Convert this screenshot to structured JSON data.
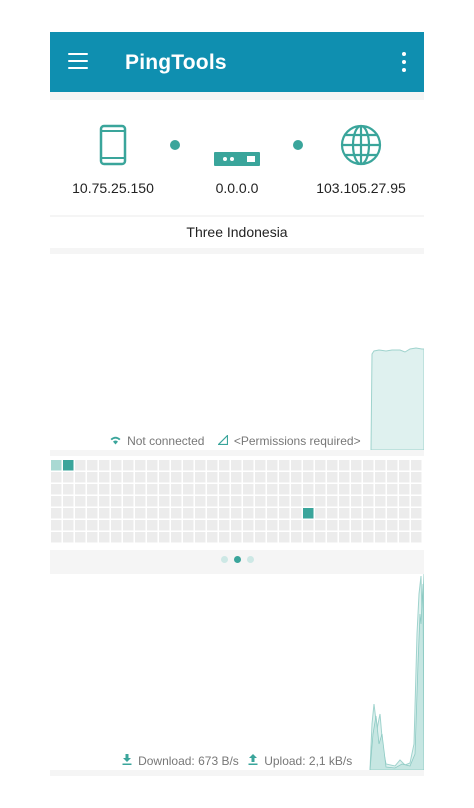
{
  "toolbar": {
    "title": "PingTools",
    "menu_icon": "hamburger-menu-icon",
    "more_icon": "more-vertical-icon",
    "color": "#0f8fb0"
  },
  "route": {
    "device": {
      "icon": "smartphone-icon",
      "ip": "10.75.25.150"
    },
    "gateway": {
      "icon": "router-icon",
      "ip": "0.0.0.0"
    },
    "internet": {
      "icon": "globe-icon",
      "ip": "103.105.27.95"
    },
    "accent": "#3aa59b"
  },
  "carrier": "Three Indonesia",
  "signal_chart": {
    "wifi_icon": "wifi-icon",
    "wifi_status": "Not connected",
    "cell_icon": "cell-signal-icon",
    "cell_status": "<Permissions required>"
  },
  "pager": {
    "pages": 3,
    "active": 1
  },
  "traffic_chart": {
    "download_icon": "download-icon",
    "download": "Download: 673 B/s",
    "upload_icon": "upload-icon",
    "upload": "Upload: 2,1 kB/s"
  }
}
